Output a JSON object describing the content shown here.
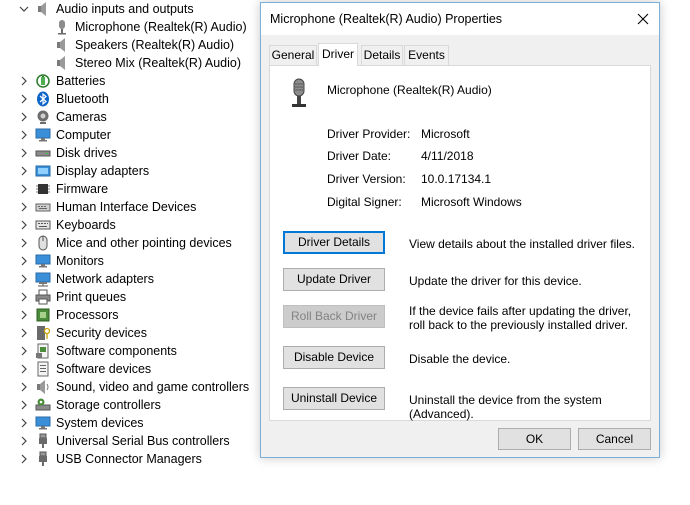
{
  "device_tree": {
    "expanded_category": {
      "label": "Audio inputs and outputs",
      "icon": "speaker-icon",
      "children": [
        {
          "label": "Microphone (Realtek(R) Audio)",
          "icon": "microphone-icon"
        },
        {
          "label": "Speakers (Realtek(R) Audio)",
          "icon": "speaker-icon"
        },
        {
          "label": "Stereo Mix (Realtek(R) Audio)",
          "icon": "speaker-icon"
        }
      ]
    },
    "categories": [
      {
        "label": "Batteries",
        "icon": "battery-icon"
      },
      {
        "label": "Bluetooth",
        "icon": "bluetooth-icon"
      },
      {
        "label": "Cameras",
        "icon": "camera-icon"
      },
      {
        "label": "Computer",
        "icon": "computer-icon"
      },
      {
        "label": "Disk drives",
        "icon": "disk-drive-icon"
      },
      {
        "label": "Display adapters",
        "icon": "display-adapter-icon"
      },
      {
        "label": "Firmware",
        "icon": "firmware-icon"
      },
      {
        "label": "Human Interface Devices",
        "icon": "hid-icon"
      },
      {
        "label": "Keyboards",
        "icon": "keyboard-icon"
      },
      {
        "label": "Mice and other pointing devices",
        "icon": "mouse-icon"
      },
      {
        "label": "Monitors",
        "icon": "monitor-icon"
      },
      {
        "label": "Network adapters",
        "icon": "network-adapter-icon"
      },
      {
        "label": "Print queues",
        "icon": "printer-icon"
      },
      {
        "label": "Processors",
        "icon": "processor-icon"
      },
      {
        "label": "Security devices",
        "icon": "security-device-icon"
      },
      {
        "label": "Software components",
        "icon": "software-component-icon"
      },
      {
        "label": "Software devices",
        "icon": "software-device-icon"
      },
      {
        "label": "Sound, video and game controllers",
        "icon": "sound-controller-icon"
      },
      {
        "label": "Storage controllers",
        "icon": "storage-controller-icon"
      },
      {
        "label": "System devices",
        "icon": "system-device-icon"
      },
      {
        "label": "Universal Serial Bus controllers",
        "icon": "usb-icon"
      },
      {
        "label": "USB Connector Managers",
        "icon": "usb-icon"
      }
    ]
  },
  "dialog": {
    "title": "Microphone (Realtek(R) Audio) Properties",
    "tabs": [
      {
        "label": "General",
        "active": false
      },
      {
        "label": "Driver",
        "active": true
      },
      {
        "label": "Details",
        "active": false
      },
      {
        "label": "Events",
        "active": false
      }
    ],
    "device_name": "Microphone (Realtek(R) Audio)",
    "properties": [
      {
        "label": "Driver Provider:",
        "value": "Microsoft"
      },
      {
        "label": "Driver Date:",
        "value": "4/11/2018"
      },
      {
        "label": "Driver Version:",
        "value": "10.0.17134.1"
      },
      {
        "label": "Digital Signer:",
        "value": "Microsoft Windows"
      }
    ],
    "actions": [
      {
        "label": "Driver Details",
        "description": "View details about the installed driver files.",
        "enabled": true,
        "focused": true
      },
      {
        "label": "Update Driver",
        "description": "Update the driver for this device.",
        "enabled": true,
        "focused": false
      },
      {
        "label": "Roll Back Driver",
        "description": "If the device fails after updating the driver, roll back to the previously installed driver.",
        "enabled": false,
        "focused": false
      },
      {
        "label": "Disable Device",
        "description": "Disable the device.",
        "enabled": true,
        "focused": false
      },
      {
        "label": "Uninstall Device",
        "description": "Uninstall the device from the system (Advanced).",
        "enabled": true,
        "focused": false
      }
    ],
    "ok_label": "OK",
    "cancel_label": "Cancel"
  },
  "colors": {
    "dialog_border": "#7aaedb",
    "focus_accent": "#0078d7",
    "button_face": "#e1e1e1",
    "disabled_text": "#838383",
    "bluetooth_blue": "#0a64c8",
    "monitor_blue": "#3b8fd9"
  }
}
